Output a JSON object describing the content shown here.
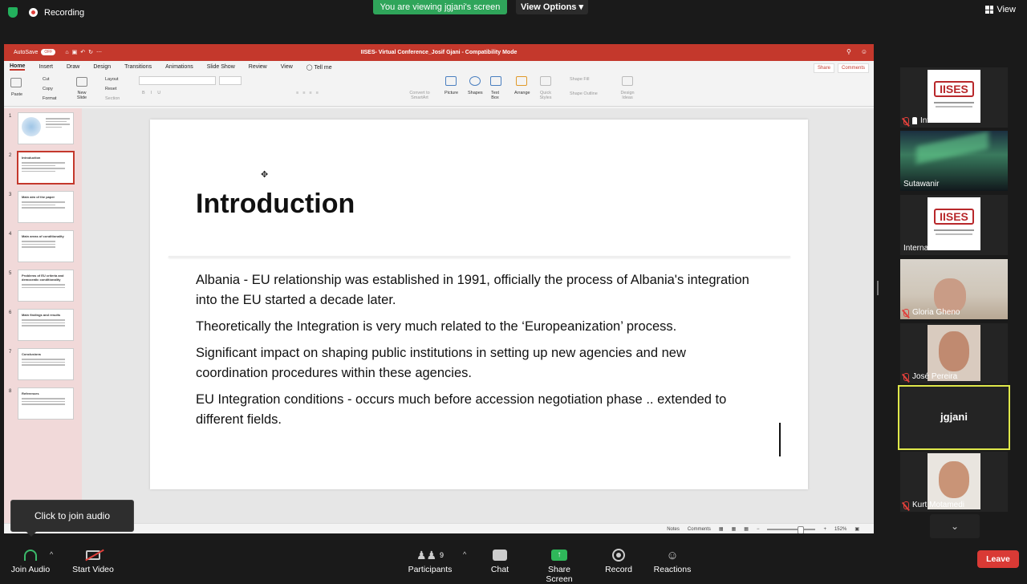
{
  "zoom_top": {
    "recording": "Recording",
    "viewing_banner": "You are viewing jgjani's screen",
    "view_options": "View Options",
    "view": "View"
  },
  "ppt": {
    "autosave": "AutoSave",
    "autosave_state": "OFF",
    "title": "IISES- Virtual Conference_Josif Gjani - Compatibility Mode",
    "tabs": [
      "Home",
      "Insert",
      "Draw",
      "Design",
      "Transitions",
      "Animations",
      "Slide Show",
      "Review",
      "View",
      "Tell me"
    ],
    "share": "Share",
    "comments": "Comments",
    "ribbon": {
      "paste": "Paste",
      "cut": "Cut",
      "copy": "Copy",
      "format": "Format",
      "new_slide": "New Slide",
      "layout": "Layout",
      "reset": "Reset",
      "section": "Section",
      "convert_smartart": "Convert to SmartArt",
      "picture": "Picture",
      "shapes": "Shapes",
      "text_box": "Text Box",
      "arrange": "Arrange",
      "quick_styles": "Quick Styles",
      "shape_fill": "Shape Fill",
      "shape_outline": "Shape Outline",
      "design_ideas": "Design Ideas"
    },
    "thumbnails": [
      {
        "num": "1",
        "title": ""
      },
      {
        "num": "2",
        "title": "Introduction"
      },
      {
        "num": "3",
        "title": "Main aim of the paper"
      },
      {
        "num": "4",
        "title": "Main areas of conditionality"
      },
      {
        "num": "5",
        "title": "Problems of EU criteria and democratic conditionality"
      },
      {
        "num": "6",
        "title": "Main findings and results"
      },
      {
        "num": "7",
        "title": "Conclusions"
      },
      {
        "num": "8",
        "title": "References"
      }
    ],
    "slide": {
      "title": "Introduction",
      "paragraphs": [
        "Albania - EU relationship was established in 1991, officially the process of Albania's integration into the EU started a decade later.",
        "Theoretically the Integration is very much related to the ‘Europeanization’ process.",
        "Significant impact on shaping public institutions in setting up new agencies and new coordination procedures within these agencies.",
        "EU Integration conditions - occurs much before accession negotiation phase .. extended to different fields."
      ]
    },
    "status": {
      "notes": "Notes",
      "comments": "Comments",
      "zoom": "152%"
    }
  },
  "join_popup": "Click to join audio",
  "participants": [
    {
      "name": "Internatio...",
      "type": "logo"
    },
    {
      "name": "Sutawanir",
      "type": "aurora"
    },
    {
      "name": "International Inst...",
      "type": "logo"
    },
    {
      "name": "Gloria Gheno",
      "type": "person1"
    },
    {
      "name": "José Pereira",
      "type": "person2"
    },
    {
      "name": "jgjani",
      "type": "self"
    },
    {
      "name": "Kurt Motamedi",
      "type": "person3"
    }
  ],
  "logo_text": "IISES",
  "toolbar": {
    "join_audio": "Join Audio",
    "start_video": "Start Video",
    "participants": "Participants",
    "participants_count": "9",
    "chat": "Chat",
    "share_screen": "Share Screen",
    "record": "Record",
    "reactions": "Reactions",
    "leave": "Leave"
  }
}
